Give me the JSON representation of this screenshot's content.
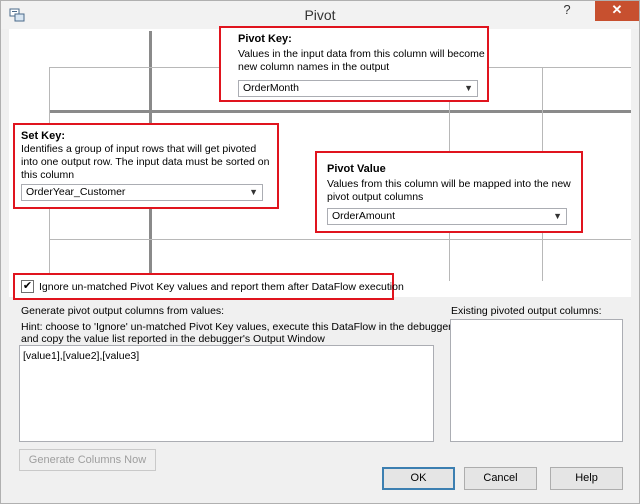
{
  "window": {
    "title": "Pivot",
    "help_glyph": "?",
    "close_glyph": "✕",
    "app_icon": "ssis-app-icon"
  },
  "pivot_key": {
    "title": "Pivot Key:",
    "description_line1": "Values in the input data from this column will become",
    "description_line2": "new column names in the output",
    "selected": "OrderMonth"
  },
  "set_key": {
    "title": "Set Key:",
    "description_line1": "Identifies a group of input rows that will get pivoted",
    "description_line2": "into one output row. The input data must be sorted on",
    "description_line3": "this column",
    "selected": "OrderYear_Customer"
  },
  "pivot_value": {
    "title": "Pivot Value",
    "description_line1": "Values from this column will be mapped into the new",
    "description_line2": "pivot output columns",
    "selected": "OrderAmount"
  },
  "ignore_option": {
    "label": "Ignore un-matched Pivot Key values and report them after DataFlow execution",
    "checked": true,
    "check_glyph": "✔"
  },
  "generate": {
    "heading": "Generate pivot output columns from values:",
    "hint_line1": "Hint: choose to 'Ignore' un-matched Pivot Key values, execute this DataFlow in the debugger",
    "hint_line2": "and copy the value list reported in the debugger's Output Window",
    "values_text": "[value1],[value2],[value3]",
    "button_label": "Generate Columns Now"
  },
  "existing": {
    "heading": "Existing pivoted output columns:"
  },
  "dialog_buttons": {
    "ok": "OK",
    "cancel": "Cancel",
    "help": "Help"
  },
  "colors": {
    "highlight": "#e0141e",
    "close": "#c7502f",
    "default_button_border": "#3c7fb1"
  }
}
